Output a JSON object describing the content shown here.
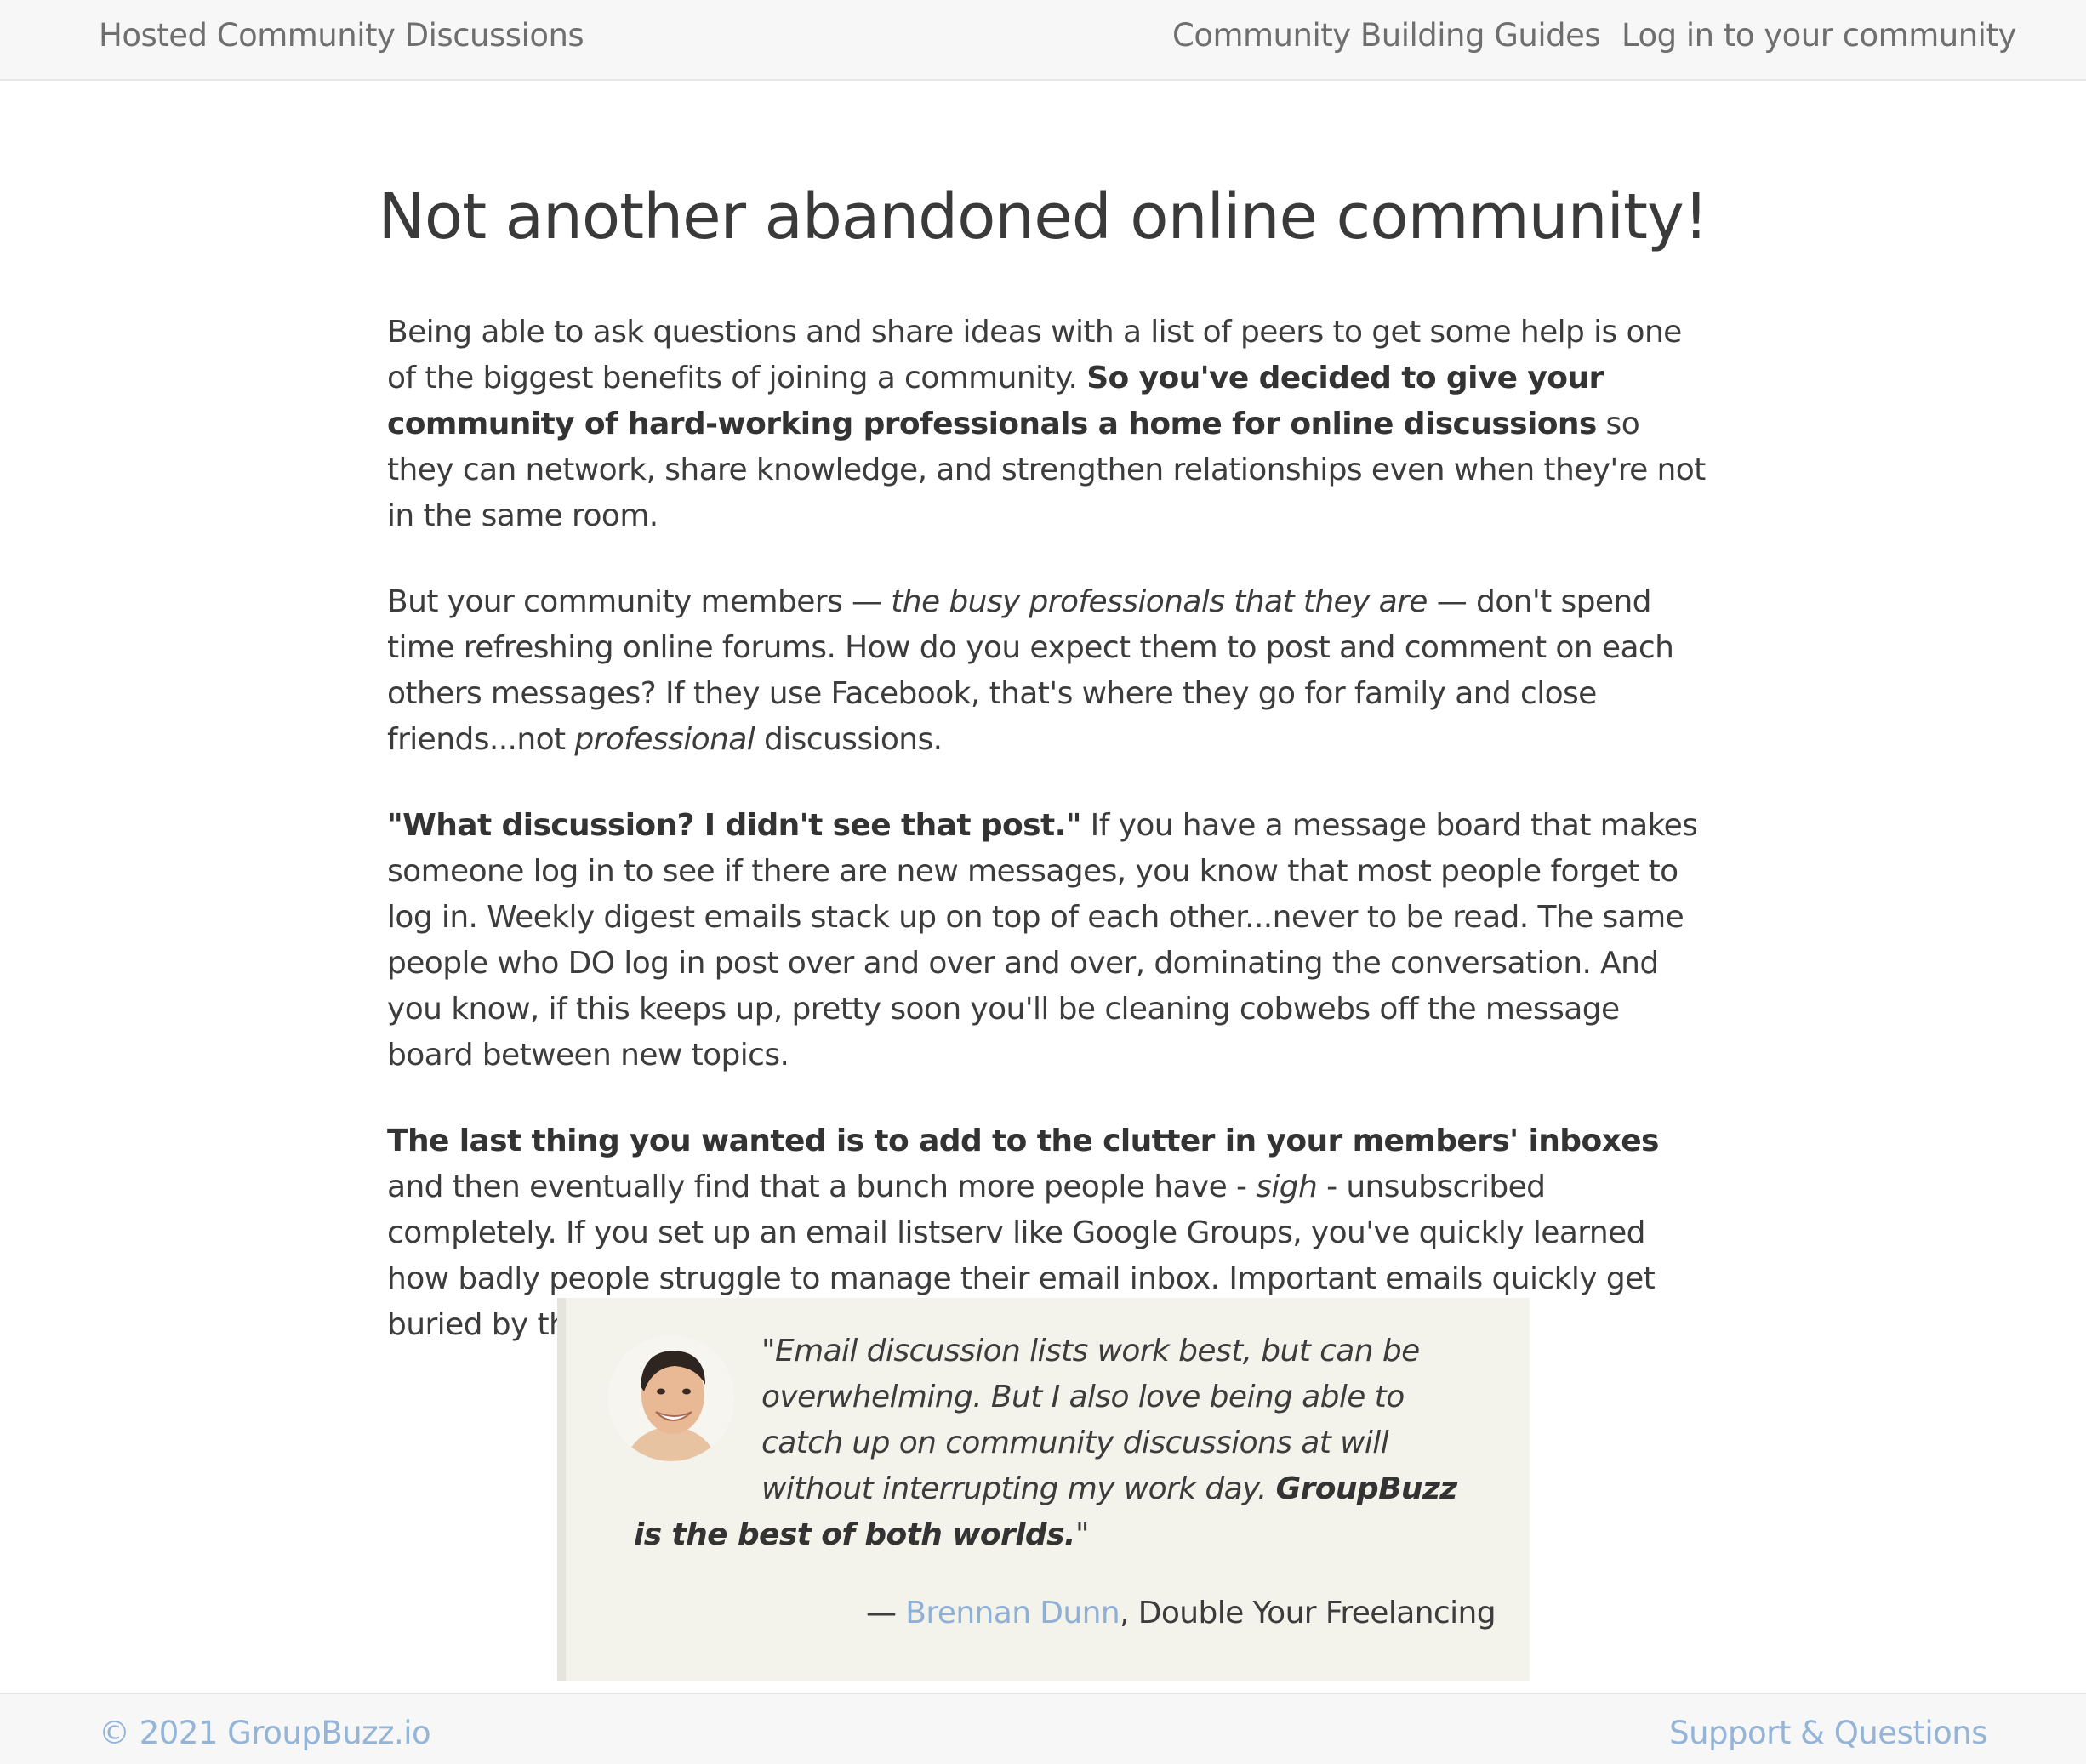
{
  "topbar": {
    "brand": "Hosted Community Discussions",
    "nav": {
      "guides": "Community Building Guides",
      "login": "Log in to your community"
    }
  },
  "main": {
    "title": "Not another abandoned online community!",
    "p1": {
      "t1": "Being able to ask questions and share ideas with a list of peers to get some help is one of the biggest benefits of joining a community. ",
      "b1": "So you've decided to give your community of hard-working professionals a home for online discussions",
      "t2": " so they can network, share knowledge, and strengthen relationships even when they're not in the same room."
    },
    "p2": {
      "t1": "But your community members — ",
      "i1": "the busy professionals that they are",
      "t2": " — don't spend time refreshing online forums. How do you expect them to post and comment on each others messages? If they use Facebook, that's where they go for family and close friends...not ",
      "i2": "professional",
      "t3": " discussions."
    },
    "p3": {
      "b1": "\"What discussion? I didn't see that post.\"",
      "t1": " If you have a message board that makes someone log in to see if there are new messages, you know that most people forget to log in. Weekly digest emails stack up on top of each other...never to be read. The same people who DO log in post over and over and over, dominating the conversation. And you know, if this keeps up, pretty soon you'll be cleaning cobwebs off the message board between new topics."
    },
    "p4": {
      "b1": "The last thing you wanted is to add to the clutter in your members' inboxes",
      "t1": " and then eventually find that a bunch more people have - ",
      "i1": "sigh",
      "t2": " - unsubscribed completely. If you set up an email listserv like Google Groups, you've quickly learned how badly people struggle to manage their email inbox. Important emails quickly get buried by the latest spam that fills their screen."
    }
  },
  "testimonial": {
    "text": "\"Email discussion lists work best, but can be overwhelming. But I also love being able to catch up on community discussions at will without interrupting my work day. ",
    "bold": "GroupBuzz is the best of both worlds.",
    "end": "\"",
    "dash": "— ",
    "author": "Brennan Dunn",
    "affiliation": ", Double Your Freelancing",
    "avatar_icon": "person-avatar"
  },
  "footer": {
    "copyright": "© 2021 GroupBuzz.io",
    "support": "Support & Questions"
  },
  "colors": {
    "link": "#94b4d8",
    "quote_bg": "#f4f3eb",
    "bar_bg": "#f7f7f7"
  }
}
